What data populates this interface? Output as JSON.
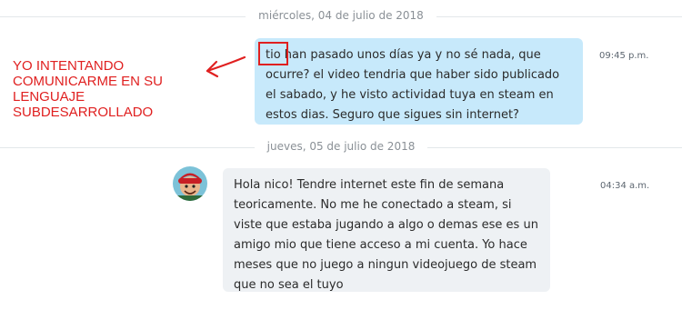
{
  "date_separators": [
    {
      "label": "miércoles, 04 de julio de 2018"
    },
    {
      "label": "jueves, 05 de julio de 2018"
    }
  ],
  "messages": [
    {
      "direction": "outgoing",
      "text": "tio han pasado unos días ya y no sé nada, que ocurre? el video tendria que haber sido publicado el sabado, y he visto actividad tuya en steam en estos dias. Seguro que sigues sin internet?",
      "time": "09:45 p.m."
    },
    {
      "direction": "incoming",
      "text": "Hola nico! Tendre internet este fin de semana teoricamente. No me he conectado a steam, si viste que estaba jugando a algo o demas ese es un amigo mio que tiene acceso a mi cuenta. Yo hace meses que no juego a ningun videojuego de steam que no sea el tuyo",
      "time": "04:34 a.m."
    }
  ],
  "annotation": {
    "text": "YO INTENTANDO COMUNICARME EN SU LENGUAJE SUBDESARROLLADO",
    "color": "#e02020"
  },
  "colors": {
    "outgoing_bubble": "#c7e9fb",
    "incoming_bubble": "#eef1f4"
  }
}
